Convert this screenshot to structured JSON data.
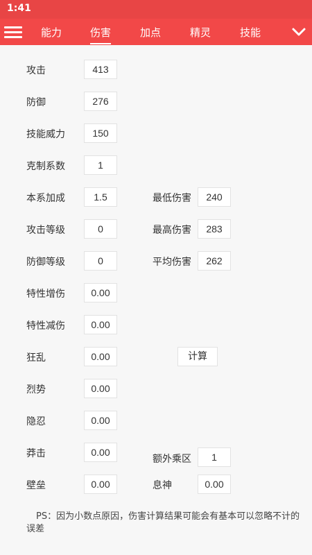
{
  "status": {
    "time": "1:41"
  },
  "tabs": [
    {
      "label": "能力"
    },
    {
      "label": "伤害"
    },
    {
      "label": "加点"
    },
    {
      "label": "精灵"
    },
    {
      "label": "技能"
    }
  ],
  "active_tab": "伤害",
  "fields": {
    "attack": {
      "label": "攻击",
      "value": "413"
    },
    "defense": {
      "label": "防御",
      "value": "276"
    },
    "skill_power": {
      "label": "技能威力",
      "value": "150"
    },
    "type_coefficient": {
      "label": "克制系数",
      "value": "1"
    },
    "stab": {
      "label": "本系加成",
      "value": "1.5"
    },
    "attack_level": {
      "label": "攻击等级",
      "value": "0"
    },
    "defense_level": {
      "label": "防御等级",
      "value": "0"
    },
    "trait_increase": {
      "label": "特性增伤",
      "value": "0.00"
    },
    "trait_decrease": {
      "label": "特性减伤",
      "value": "0.00"
    },
    "frenzy": {
      "label": "狂乱",
      "value": "0.00"
    },
    "fierce": {
      "label": "烈势",
      "value": "0.00"
    },
    "endure": {
      "label": "隐忍",
      "value": "0.00"
    },
    "reckless": {
      "label": "莽击",
      "value": "0.00"
    },
    "barrier": {
      "label": "壁垒",
      "value": "0.00"
    }
  },
  "results": {
    "min_damage": {
      "label": "最低伤害",
      "value": "240"
    },
    "max_damage": {
      "label": "最高伤害",
      "value": "283"
    },
    "avg_damage": {
      "label": "平均伤害",
      "value": "262"
    },
    "extra_multiplier": {
      "label": "额外乘区",
      "value": "1"
    },
    "calm": {
      "label": "息神",
      "value": "0.00"
    }
  },
  "calculate_label": "计算",
  "note": "PS：因为小数点原因，伤害计算结果可能会有基本可以忽略不计的误差",
  "colors": {
    "header": "#f24848",
    "statusbar": "#e84545"
  }
}
